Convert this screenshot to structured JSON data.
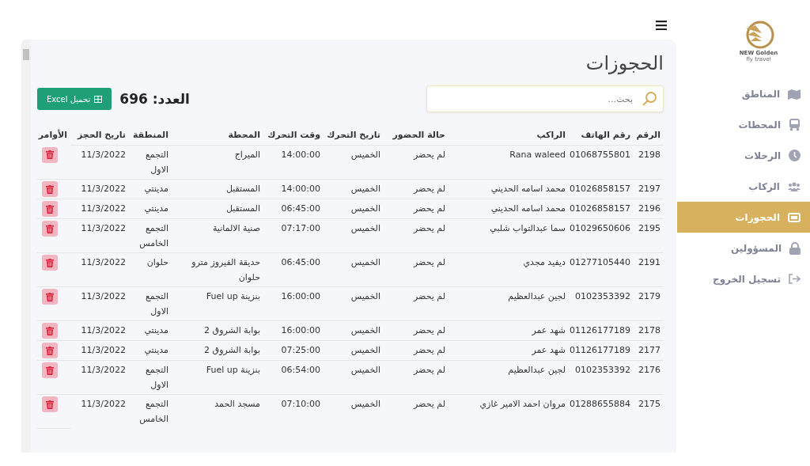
{
  "sidebar": {
    "logo": {
      "title": "NEW Golden",
      "subtitle": "fly travel"
    },
    "items": [
      {
        "label": "المناطق",
        "selected": false
      },
      {
        "label": "المحطات",
        "selected": false
      },
      {
        "label": "الرحلات",
        "selected": false
      },
      {
        "label": "الركاب",
        "selected": false
      },
      {
        "label": "الحجوزات",
        "selected": true
      },
      {
        "label": "المسؤولين",
        "selected": false
      },
      {
        "label": "تسجيل الخروج",
        "selected": false
      }
    ]
  },
  "page": {
    "title": "الحجوزات",
    "search": {
      "placeholder": "بحث..."
    },
    "count": "العدد: 696",
    "export_button": "تحميل Excel"
  },
  "table": {
    "columns": [
      "الرقم",
      "رقم الهاتف",
      "الراكب",
      "حالة الحضور",
      "تاريخ التحرك",
      "وقت التحرك",
      "المحطة",
      "المنطقة",
      "تاريخ الحجز",
      "الأوامر"
    ],
    "rows": [
      [
        "2198",
        "01068755801",
        "Rana waleed",
        "لم يحضر",
        "الخميس",
        "14:00:00",
        "الميراج",
        "التجمع الاول",
        "11/3/2022"
      ],
      [
        "2197",
        "01026858157",
        "محمد اسامه الحديني",
        "لم يحضر",
        "الخميس",
        "14:00:00",
        "المستقبل",
        "مدينتي",
        "11/3/2022"
      ],
      [
        "2196",
        "01026858157",
        "محمد اسامه الحديني",
        "لم يحضر",
        "الخميس",
        "06:45:00",
        "المستقبل",
        "مدينتي",
        "11/3/2022"
      ],
      [
        "2195",
        "01029650606",
        "سما عبدالتواب شلبي",
        "لم يحضر",
        "الخميس",
        "07:17:00",
        "صنية الالمانية",
        "التجمع الخامس",
        "11/3/2022"
      ],
      [
        "2191",
        "01277105440",
        "ديفيد مجدي",
        "لم يحضر",
        "الخميس",
        "06:45:00",
        "حديقة الفيروز مترو حلوان",
        "حلوان",
        "11/3/2022"
      ],
      [
        "2179",
        "0102353392",
        "لجين عبدالعظيم",
        "لم يحضر",
        "الخميس",
        "16:00:00",
        "بنزينة Fuel up",
        "التجمع الاول",
        "11/3/2022"
      ],
      [
        "2178",
        "01126177189",
        "شهد عمر",
        "لم يحضر",
        "الخميس",
        "16:00:00",
        "بوابة الشروق 2",
        "مدينتي",
        "11/3/2022"
      ],
      [
        "2177",
        "01126177189",
        "شهد عمر",
        "لم يحضر",
        "الخميس",
        "07:25:00",
        "بوابة الشروق 2",
        "مدينتي",
        "11/3/2022"
      ],
      [
        "2176",
        "0102353392",
        "لجين عبدالعظيم",
        "لم يحضر",
        "الخميس",
        "06:54:00",
        "بنزينة Fuel up",
        "التجمع الاول",
        "11/3/2022"
      ],
      [
        "2175",
        "01288655884",
        "مروان احمد الامير غازي",
        "لم يحضر",
        "الخميس",
        "07:10:00",
        "مسجد الحمد",
        "التجمع الخامس",
        "11/3/2022"
      ]
    ]
  }
}
